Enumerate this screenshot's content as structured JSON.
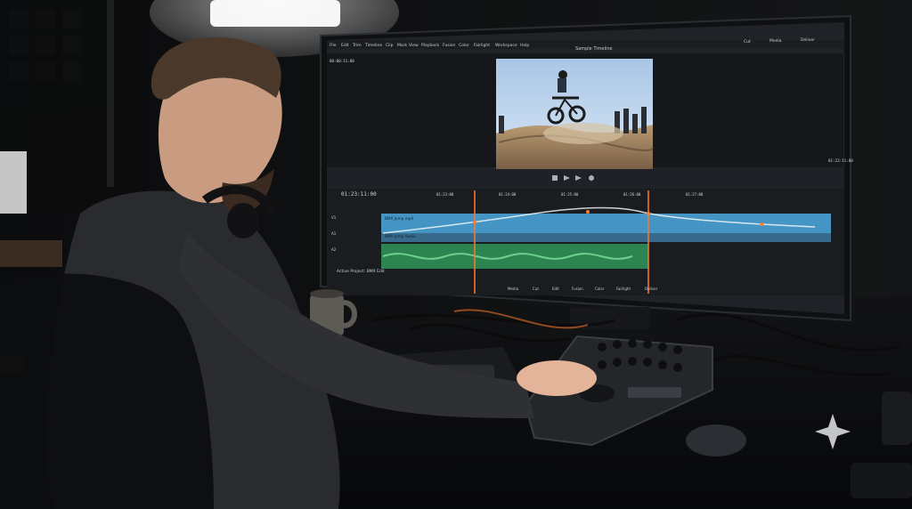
{
  "scene": {
    "type": "photo",
    "subject": "video editor at desk",
    "colors": {
      "background": "#0f0f10",
      "monitor_bezel": "#111214",
      "ui_bg": "#202227",
      "timeline_bg": "#1a1c20",
      "accent_orange": "#ff7a2f",
      "track_blue": "#4aa3d6",
      "audio_green": "#3bb06b"
    }
  },
  "editor": {
    "menu": {
      "items": [
        "File",
        "Edit",
        "Trim",
        "Timeline",
        "Clip",
        "Mark",
        "View",
        "Playback",
        "Fusion",
        "Color",
        "Fairlight",
        "Workspace",
        "Help"
      ],
      "title": "Sample Timeline",
      "right_buttons": [
        "Cut",
        "Media",
        "Deliver"
      ]
    },
    "viewer": {
      "timecode_top": "00:00:11:00",
      "timecode_bottom": "01:23:11:00"
    },
    "timeline": {
      "timecode": "01:23:11:00",
      "markers": [
        "01:23:00",
        "01:24:00",
        "01:25:00",
        "01:26:00",
        "01:27:00"
      ],
      "track_labels": [
        "V1",
        "A1",
        "A2"
      ],
      "clip_labels": [
        "BMX Jump.mp4",
        "BMX Jump Audio"
      ],
      "bottom_tabs": [
        "Media",
        "Cut",
        "Edit",
        "Fusion",
        "Color",
        "Fairlight",
        "Deliver"
      ],
      "status_left": "Active Project: BMX Edit"
    }
  }
}
